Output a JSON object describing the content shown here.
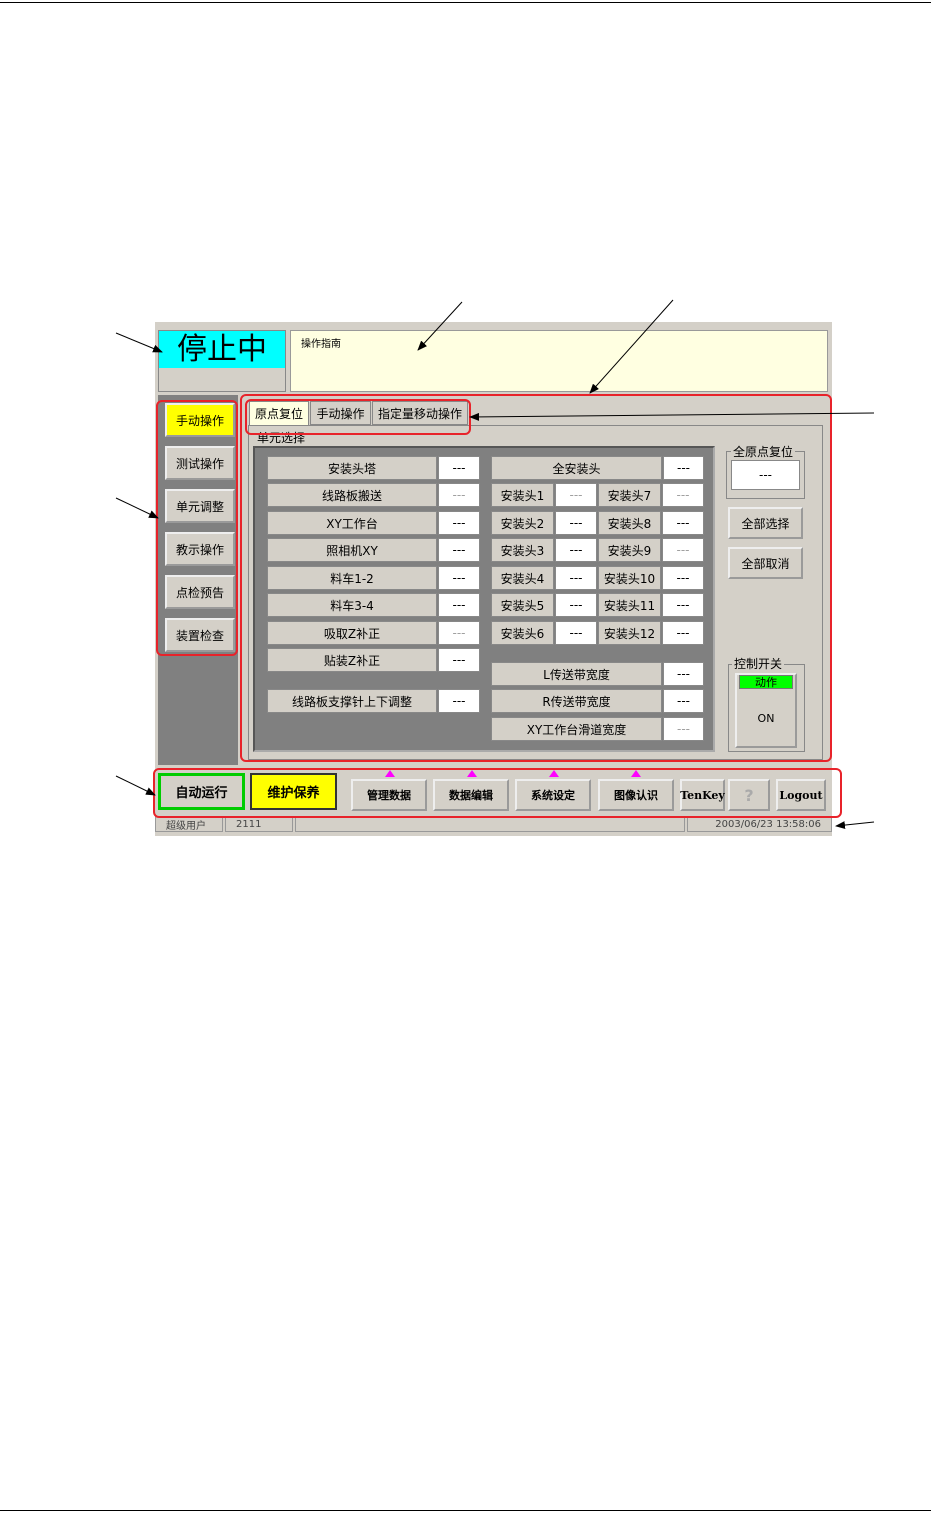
{
  "status": {
    "text": "停止中"
  },
  "guide": {
    "label": "操作指南"
  },
  "side_menu": [
    "手动操作",
    "测试操作",
    "单元调整",
    "教示操作",
    "点检预告",
    "装置检查"
  ],
  "tabs": [
    "原点复位",
    "手动操作",
    "指定量移动操作"
  ],
  "unit_select": {
    "group_label": "单元选择",
    "left_rows": [
      {
        "label": "安装头塔",
        "value": "---"
      },
      {
        "label": "线路板搬送",
        "value": "---"
      },
      {
        "label": "XY工作台",
        "value": "---"
      },
      {
        "label": "照相机XY",
        "value": "---"
      },
      {
        "label": "料车1-2",
        "value": "---"
      },
      {
        "label": "料车3-4",
        "value": "---"
      },
      {
        "label": "吸取Z补正",
        "value": "---"
      },
      {
        "label": "贴装Z补正",
        "value": "---"
      }
    ],
    "support_pin": {
      "label": "线路板支撑针上下调整",
      "value": "---"
    },
    "all_heads": {
      "label": "全安装头",
      "value": "---"
    },
    "heads": [
      {
        "label": "安装头1",
        "value": "---"
      },
      {
        "label": "安装头7",
        "value": "---"
      },
      {
        "label": "安装头2",
        "value": "---"
      },
      {
        "label": "安装头8",
        "value": "---"
      },
      {
        "label": "安装头3",
        "value": "---"
      },
      {
        "label": "安装头9",
        "value": "---"
      },
      {
        "label": "安装头4",
        "value": "---"
      },
      {
        "label": "安装头10",
        "value": "---"
      },
      {
        "label": "安装头5",
        "value": "---"
      },
      {
        "label": "安装头11",
        "value": "---"
      },
      {
        "label": "安装头6",
        "value": "---"
      },
      {
        "label": "安装头12",
        "value": "---"
      }
    ],
    "widths": [
      {
        "label": "L传送带宽度",
        "value": "---"
      },
      {
        "label": "R传送带宽度",
        "value": "---"
      },
      {
        "label": "XY工作台滑道宽度",
        "value": "---"
      }
    ]
  },
  "origin_reset": {
    "label": "全原点复位",
    "value": "---",
    "select_all": "全部选择",
    "cancel_all": "全部取消"
  },
  "control_switch": {
    "label": "控制开关",
    "indicator": "动作",
    "button": "ON"
  },
  "bottom": {
    "auto_run": "自动运行",
    "maintenance": "维护保养",
    "buttons": [
      "管理数据",
      "数据编辑",
      "系统设定",
      "图像认识"
    ],
    "tenkey": "TenKey",
    "help": "?",
    "logout": "Logout"
  },
  "statusbar": {
    "user": "超级用户",
    "code": "2111",
    "datetime": "2003/06/23 13:58:06"
  },
  "colors": {
    "highlight": "#ff0000",
    "active_yellow": "#ffff00",
    "status_cyan": "#00ffff",
    "auto_green": "#00cc00"
  }
}
